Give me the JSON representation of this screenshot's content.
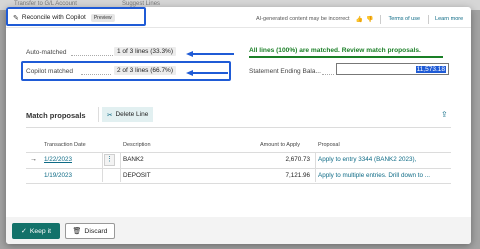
{
  "background": {
    "items": [
      "Transfer to G/L Account",
      "Suggest Lines"
    ]
  },
  "header": {
    "title": "Reconcile with Copilot",
    "badge": "Preview",
    "disclaimer": "AI-generated content may be incorrect",
    "terms_link": "Terms of use",
    "learn_link": "Learn more"
  },
  "summary": {
    "auto_label": "Auto-matched",
    "auto_value": "1 of 3 lines (33.3%)",
    "copilot_label": "Copilot matched",
    "copilot_value": "2 of 3 lines (66.7%)",
    "message": "All lines (100%) are matched. Review match proposals.",
    "ending_label": "Statement Ending Bala...",
    "ending_value": "11,573.18"
  },
  "proposals": {
    "title": "Match proposals",
    "delete_label": "Delete Line",
    "columns": [
      "Transaction Date",
      "Description",
      "Amount to Apply",
      "Proposal"
    ],
    "rows": [
      {
        "date": "1/22/2023",
        "description": "BANK2",
        "amount": "2,670.73",
        "proposal": "Apply to entry 3344 (BANK2 2023),"
      },
      {
        "date": "1/19/2023",
        "description": "DEPOSIT",
        "amount": "7,121.96",
        "proposal": "Apply to multiple entries. Drill down to ..."
      }
    ]
  },
  "footer": {
    "keep_label": "Keep it",
    "discard_label": "Discard"
  },
  "colors": {
    "annotation": "#1f5bd6",
    "success": "#1a7f26",
    "accent": "#13726a",
    "link": "#0e6b86"
  }
}
